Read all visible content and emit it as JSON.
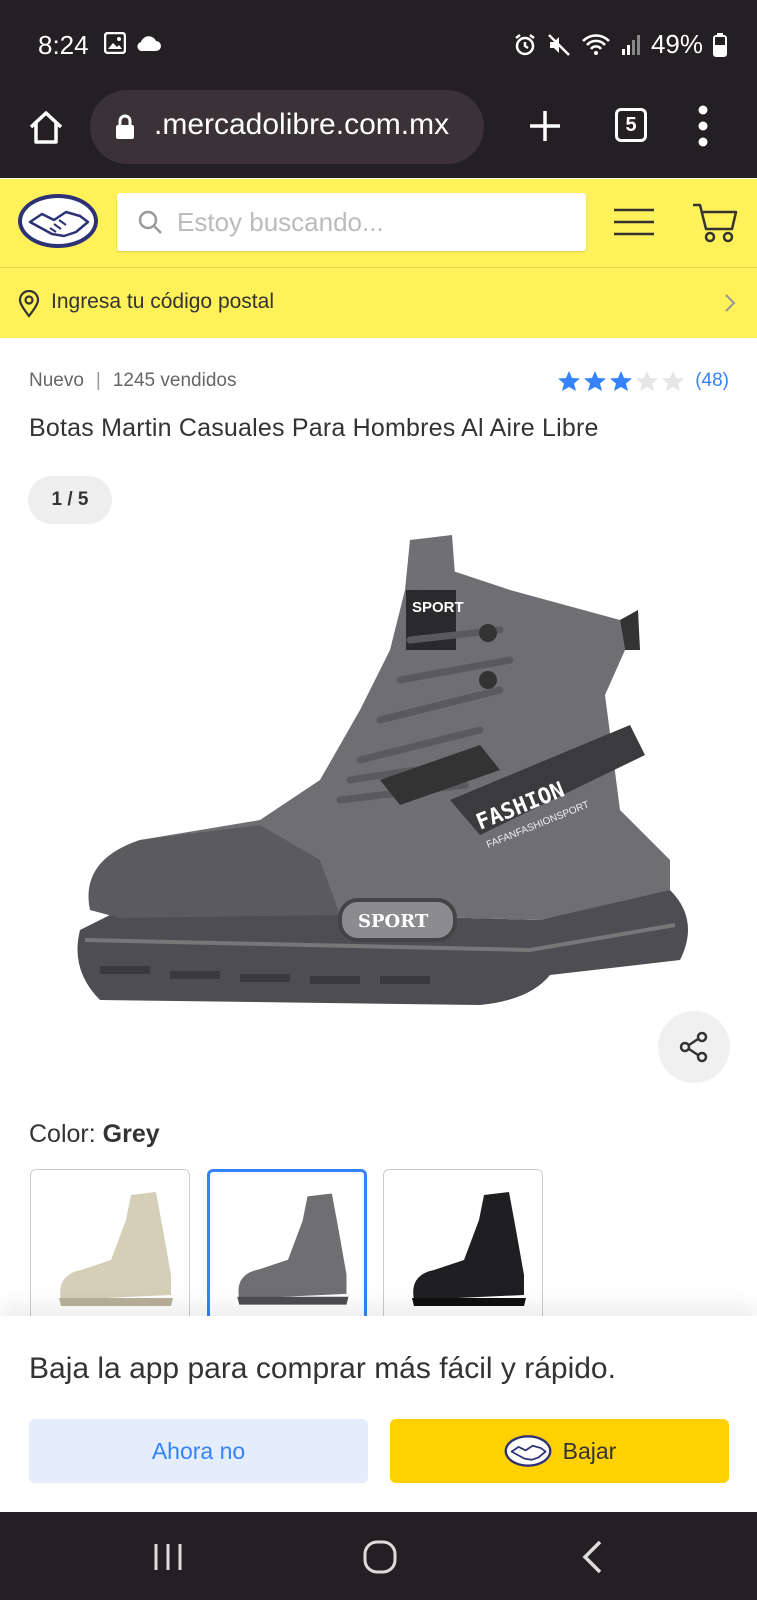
{
  "status_bar": {
    "time": "8:24",
    "battery": "49%",
    "icons": [
      "image-icon",
      "cloud-icon",
      "alarm-icon",
      "mute-icon",
      "wifi-icon",
      "signal-icon",
      "battery-icon"
    ]
  },
  "browser": {
    "url": ".mercadolibre.com.mx",
    "tab_count": "5",
    "icons": [
      "home-icon",
      "lock-icon",
      "plus-icon",
      "tabs-icon",
      "more-vertical-icon"
    ]
  },
  "header": {
    "search_placeholder": "Estoy buscando...",
    "postal_label": "Ingresa tu código postal",
    "brand_color": "#fff159"
  },
  "product": {
    "condition": "Nuevo",
    "sold": "1245 vendidos",
    "rating_stars": 3,
    "rating_max": 5,
    "rating_count": "(48)",
    "title": "Botas Martin Casuales Para Hombres Al Aire Libre",
    "pager": "1 / 5",
    "image_labels": [
      "SPORT",
      "FASHION",
      "FAFANFASHIONSPORT",
      "SPORT"
    ],
    "color_prefix": "Color: ",
    "color_value": "Grey",
    "swatches": [
      {
        "name": "beige",
        "color": "#d6cfb7",
        "selected": false
      },
      {
        "name": "grey",
        "color": "#6f6f72",
        "selected": true
      },
      {
        "name": "black",
        "color": "#1f1f21",
        "selected": false
      }
    ]
  },
  "app_banner": {
    "text": "Baja la app para comprar más fácil y rápido.",
    "dismiss_label": "Ahora no",
    "download_label": "Bajar",
    "accent": "#3483fa",
    "yellow": "#ffd100"
  },
  "nav_bar": {
    "icons": [
      "recents-icon",
      "home-circle-icon",
      "back-icon"
    ]
  }
}
